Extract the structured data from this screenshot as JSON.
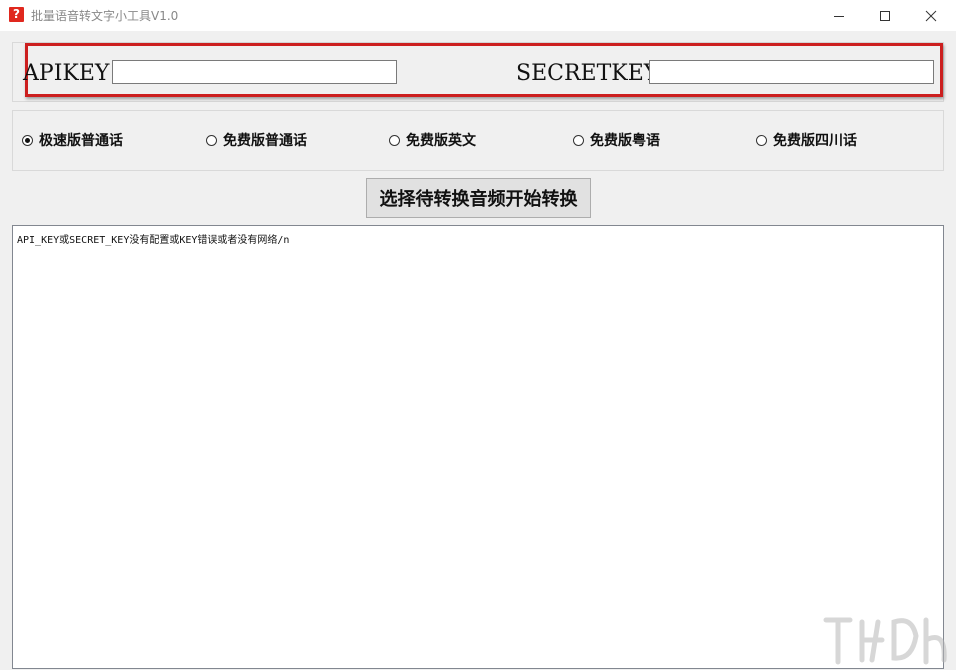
{
  "window": {
    "title": "批量语音转文字小工具V1.0",
    "icon_glyph": "?",
    "icon_color": "#e0281e"
  },
  "keys": {
    "apikey_label": "APIKEY",
    "apikey_value": "",
    "secretkey_label": "SECRETKEY",
    "secretkey_value": "",
    "highlight_color": "#cc1f1f"
  },
  "modes": {
    "options": [
      {
        "label": "极速版普通话",
        "selected": true
      },
      {
        "label": "免费版普通话",
        "selected": false
      },
      {
        "label": "免费版英文",
        "selected": false
      },
      {
        "label": "免费版粤语",
        "selected": false
      },
      {
        "label": "免费版四川话",
        "selected": false
      }
    ]
  },
  "actions": {
    "convert_label": "选择待转换音频开始转换"
  },
  "output": {
    "text": "API_KEY或SECRET_KEY没有配置或KEY错误或者没有网络/n"
  }
}
